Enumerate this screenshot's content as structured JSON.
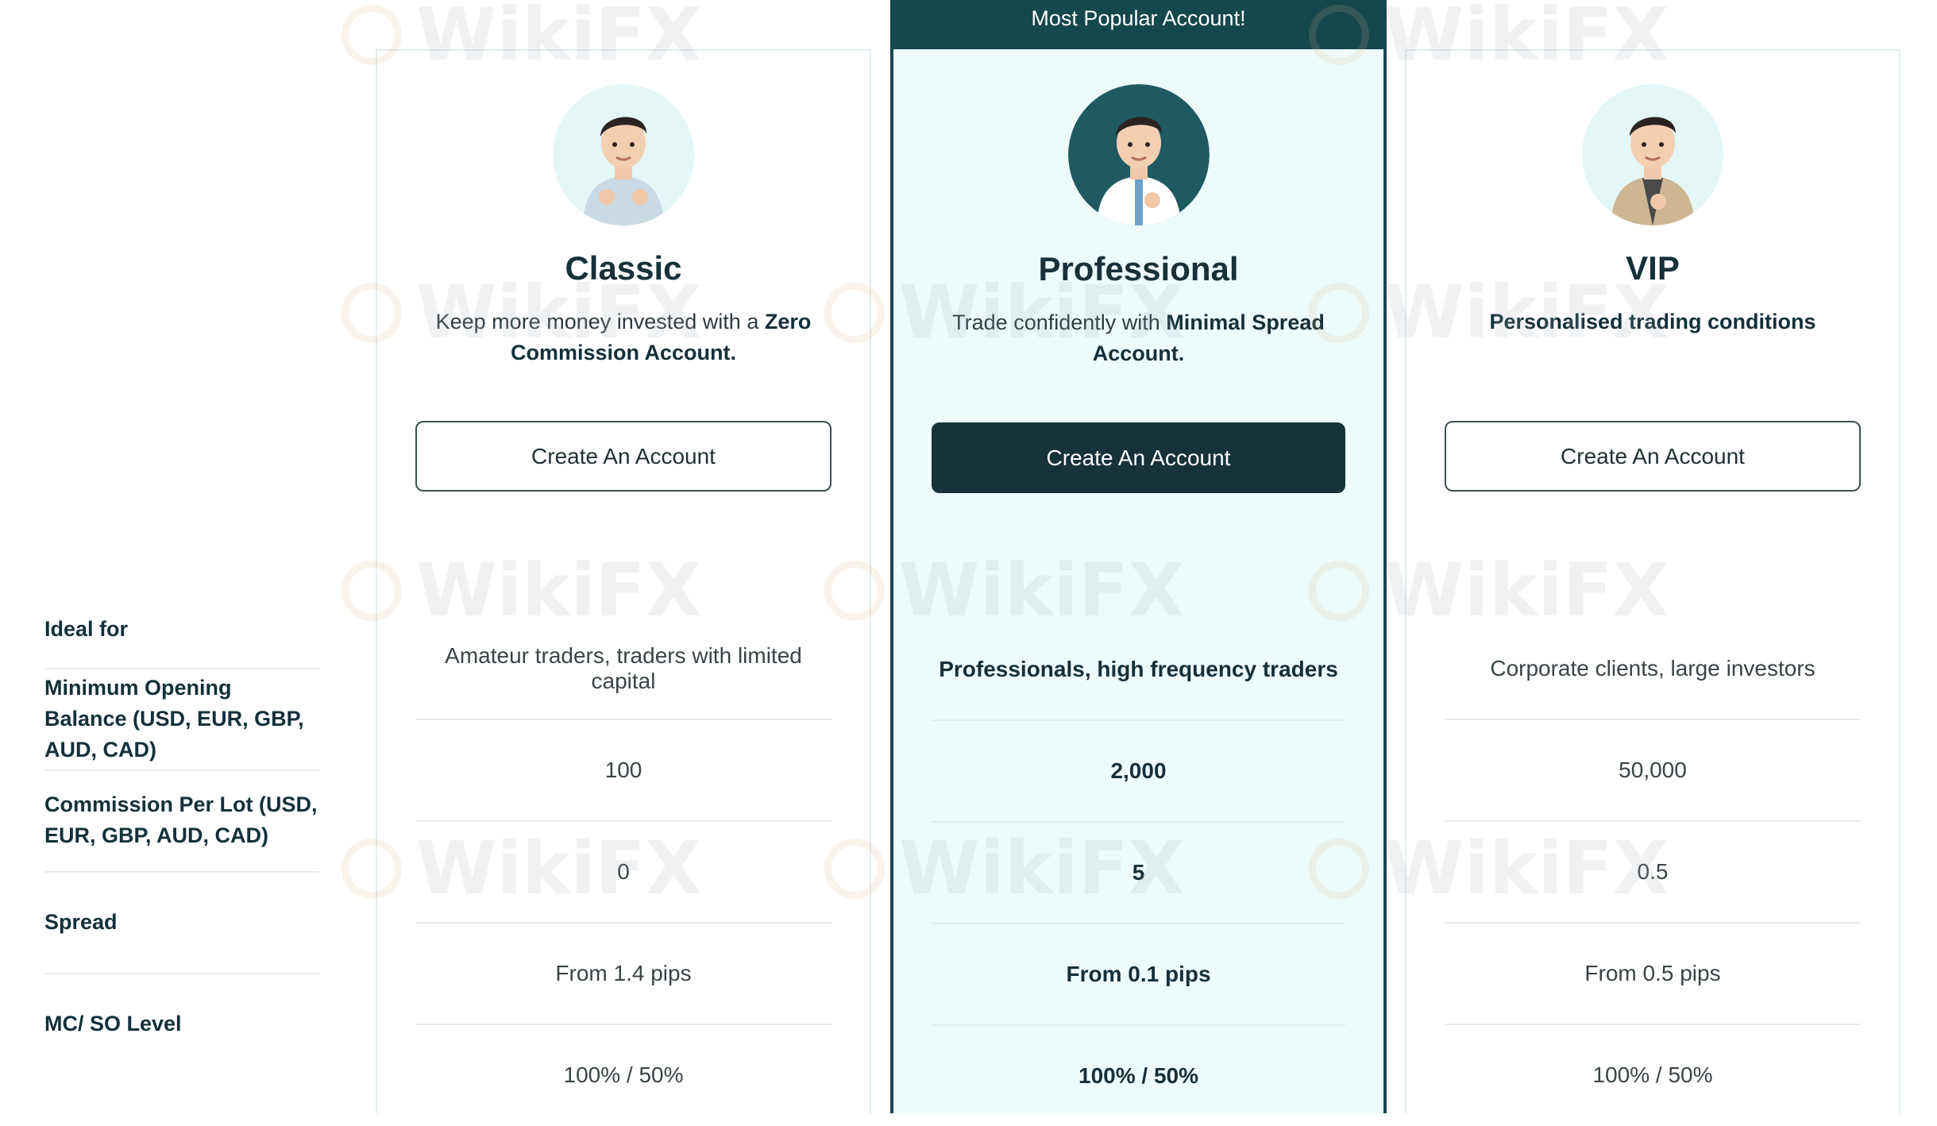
{
  "banner": {
    "text": "Most Popular Account!"
  },
  "row_labels": [
    "Ideal for",
    "Minimum Opening Balance (USD, EUR, GBP, AUD, CAD)",
    "Commission Per Lot (USD, EUR, GBP, AUD, CAD)",
    "Spread",
    "MC/ SO Level"
  ],
  "plans": [
    {
      "name": "Classic",
      "desc_plain": "Keep more money invested with a ",
      "desc_bold": "Zero Commission Account.",
      "button": "Create An Account",
      "values": [
        "Amateur traders, traders with limited capital",
        "100",
        "0",
        "From 1.4 pips",
        "100% / 50%"
      ]
    },
    {
      "name": "Professional",
      "desc_plain": "Trade confidently with ",
      "desc_bold": "Minimal Spread Account.",
      "button": "Create An Account",
      "values": [
        "Professionals, high frequency traders",
        "2,000",
        "5",
        "From 0.1 pips",
        "100% / 50%"
      ]
    },
    {
      "name": "VIP",
      "desc_plain": "",
      "desc_bold": "Personalised trading conditions",
      "button": "Create An Account",
      "values": [
        "Corporate clients, large investors",
        "50,000",
        "0.5",
        "From 0.5 pips",
        "100% / 50%"
      ]
    }
  ],
  "watermark": "WikiFX",
  "colors": {
    "brand_dark": "#16464e",
    "featured_bg": "#eefbfb",
    "button_dark": "#16323a"
  }
}
